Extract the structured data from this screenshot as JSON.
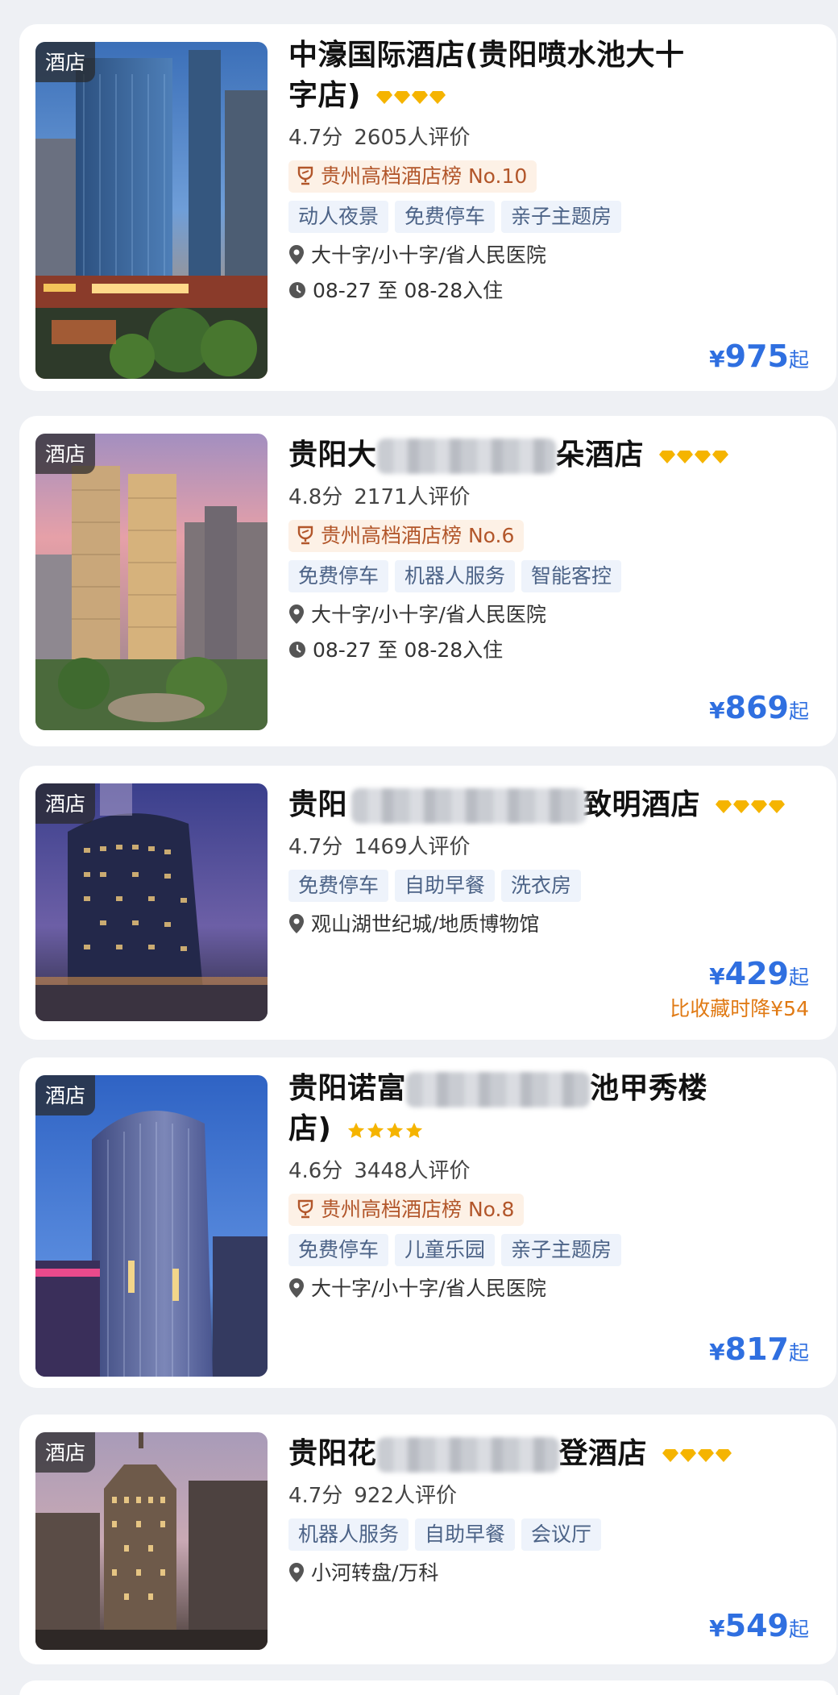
{
  "colors": {
    "price_blue": "#2f6fe0",
    "rank_text": "#b2562a",
    "rank_bg": "#fdf1e6",
    "facility_text": "#4c6387",
    "facility_bg": "#eef3fb",
    "star_gold": "#f5b400",
    "price_drop": "#e07a14"
  },
  "hotels": [
    {
      "type": "酒店",
      "name_line1": "中濠国际酒店(贵阳喷水池大十",
      "name_line2": "字店)",
      "stars": 4,
      "star_style": "diamond",
      "score": "4.7分",
      "reviews": "2605人评价",
      "rank": "贵州高档酒店榜 No.10",
      "facilities": [
        "动人夜景",
        "免费停车",
        "亲子主题房"
      ],
      "location": "大十字/小十字/省人民医院",
      "dates": "08-27 至 08-28入住",
      "currency": "¥",
      "price": "975",
      "price_suffix": "起"
    },
    {
      "type": "酒店",
      "name_prefix": "贵阳大",
      "name_suffix": "朵酒店",
      "stars": 4,
      "star_style": "diamond",
      "score": "4.8分",
      "reviews": "2171人评价",
      "rank": "贵州高档酒店榜 No.6",
      "facilities": [
        "免费停车",
        "机器人服务",
        "智能客控"
      ],
      "location": "大十字/小十字/省人民医院",
      "dates": "08-27 至 08-28入住",
      "currency": "¥",
      "price": "869",
      "price_suffix": "起"
    },
    {
      "type": "酒店",
      "name_prefix": "贵阳",
      "name_suffix": "致明酒店",
      "stars": 4,
      "star_style": "diamond",
      "score": "4.7分",
      "reviews": "1469人评价",
      "facilities": [
        "免费停车",
        "自助早餐",
        "洗衣房"
      ],
      "location": "观山湖世纪城/地质博物馆",
      "currency": "¥",
      "price": "429",
      "price_suffix": "起",
      "price_drop": "比收藏时降¥54"
    },
    {
      "type": "酒店",
      "name_prefix": "贵阳诺富",
      "name_suffix": "池甲秀楼",
      "name_line2": "店)",
      "stars": 4,
      "star_style": "star",
      "score": "4.6分",
      "reviews": "3448人评价",
      "rank": "贵州高档酒店榜 No.8",
      "facilities": [
        "免费停车",
        "儿童乐园",
        "亲子主题房"
      ],
      "location": "大十字/小十字/省人民医院",
      "currency": "¥",
      "price": "817",
      "price_suffix": "起"
    },
    {
      "type": "酒店",
      "name_prefix": "贵阳花",
      "name_suffix": "登酒店",
      "stars": 4,
      "star_style": "diamond",
      "score": "4.7分",
      "reviews": "922人评价",
      "facilities": [
        "机器人服务",
        "自助早餐",
        "会议厅"
      ],
      "location": "小河转盘/万科",
      "currency": "¥",
      "price": "549",
      "price_suffix": "起"
    }
  ]
}
